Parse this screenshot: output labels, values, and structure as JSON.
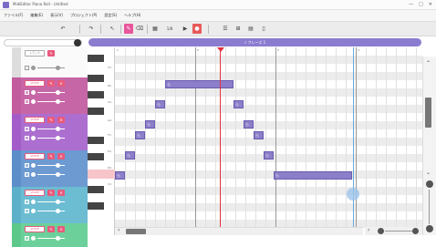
{
  "window": {
    "title": "MidiEditor Piano Roll - Untitled",
    "controls": [
      "—",
      "□",
      "✕"
    ]
  },
  "menu": [
    "ファイル(F)",
    "編集(E)",
    "表示(V)",
    "プロジェクト(P)",
    "設定(S)",
    "ヘルプ(H)"
  ],
  "toolbar": {
    "undo": "↶",
    "redo": "↷",
    "tools": [
      "↖",
      "✎",
      "⌫",
      "1/8",
      "▶",
      "●"
    ]
  },
  "header": {
    "phrase_label": "♪ フレーズ 1"
  },
  "tracks": [
    {
      "label": "トラック",
      "color": "#ffffff"
    },
    {
      "label": "VOICE",
      "color": "#c35c9e"
    },
    {
      "label": "VOICE",
      "color": "#a35cc9"
    },
    {
      "label": "VOICE",
      "color": "#5c8ec9"
    },
    {
      "label": "VOICE",
      "color": "#5cb0c9"
    },
    {
      "label": "VOICE",
      "color": "#5cc98a"
    }
  ],
  "keys": [
    "C5",
    "B4",
    "A4",
    "G4",
    "F4",
    "E4",
    "D4",
    "C4"
  ],
  "bars": [
    "1",
    "2",
    "3",
    "4",
    "5"
  ],
  "notes": [
    {
      "label": "ら"
    },
    {
      "label": "ら"
    },
    {
      "label": "ら"
    },
    {
      "label": "ら"
    },
    {
      "label": "ら"
    },
    {
      "label": "ら"
    },
    {
      "label": "ら"
    },
    {
      "label": "ら"
    },
    {
      "label": "ら"
    },
    {
      "label": "ら"
    },
    {
      "label": "ら"
    }
  ],
  "icons": [
    "app-icon",
    "undo-icon",
    "redo-icon",
    "pointer-icon",
    "pencil-icon",
    "eraser-icon",
    "play-icon",
    "record-icon"
  ]
}
